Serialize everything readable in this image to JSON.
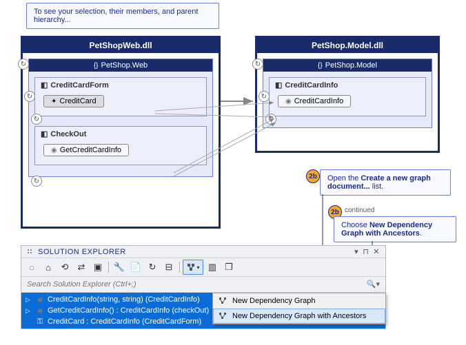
{
  "callouts": {
    "top": "To see your selection, their members, and parent hierarchy...",
    "b1_prefix": "Open the ",
    "b1_bold": "Create a new graph document...",
    "b1_suffix": " list.",
    "b2_tag": "continued",
    "b2_prefix": "Choose ",
    "b2_bold": "New Dependency Graph with Ancestors",
    "b2_suffix": ".",
    "badge": "2b"
  },
  "diagram": {
    "left_dll": "PetShopWeb.dll",
    "right_dll": "PetShop.Model.dll",
    "left_ns": "PetShop.Web",
    "right_ns": "PetShop.Model",
    "classes": {
      "ccform": "CreditCardForm",
      "ccform_member": "CreditCard",
      "checkout": "CheckOut",
      "checkout_member": "GetCreditCardInfo",
      "ccinfo": "CreditCardInfo",
      "ccinfo_member": "CreditCardInfo"
    }
  },
  "solution_explorer": {
    "title": "SOLUTION EXPLORER",
    "search_placeholder": "Search Solution Explorer (Ctrl+;)",
    "rows": [
      "CreditCardInfo(string, string) (CreditCardInfo)",
      "GetCreditCardInfo() : CreditCardInfo (checkOut)",
      "CreditCard : CreditCardInfo (CreditCardForm)"
    ],
    "row_icons": [
      "method",
      "method",
      "prop"
    ],
    "row_tri": [
      "tri",
      "tri",
      "none"
    ]
  },
  "context_menu": {
    "item1": "New Dependency Graph",
    "item2": "New Dependency Graph with Ancestors"
  }
}
